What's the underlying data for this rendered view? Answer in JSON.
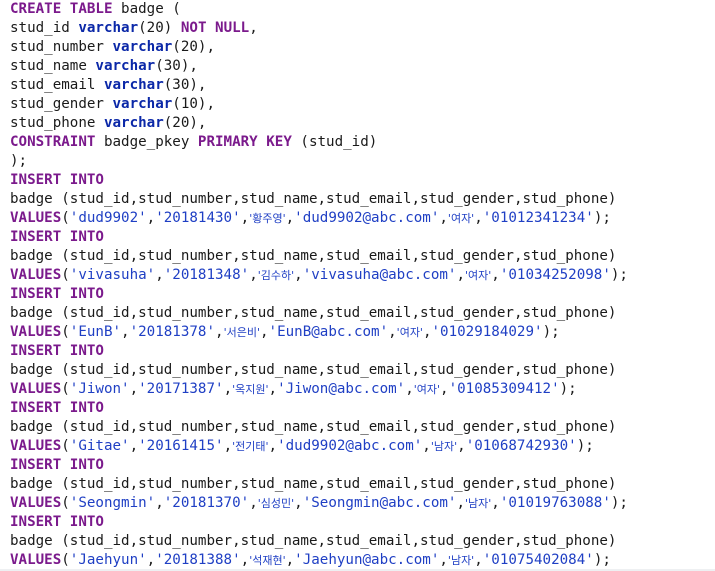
{
  "ddl": {
    "l1": {
      "kw": "CREATE TABLE",
      "rest": " badge ("
    },
    "l2": {
      "col": "stud_id ",
      "type": "varchar",
      "args": "(20) ",
      "kw1": "NOT",
      "sp": " ",
      "kw2": "NULL",
      "tail": ","
    },
    "l3": {
      "col": "stud_number ",
      "type": "varchar",
      "args": "(20),"
    },
    "l4": {
      "col": "stud_name ",
      "type": "varchar",
      "args": "(30),"
    },
    "l5": {
      "col": "stud_email ",
      "type": "varchar",
      "args": "(30),"
    },
    "l6": {
      "col": "stud_gender ",
      "type": "varchar",
      "args": "(10),"
    },
    "l7": {
      "col": "stud_phone ",
      "type": "varchar",
      "args": "(20),"
    },
    "l8": {
      "kw1": "CONSTRAINT",
      "name": " badge_pkey ",
      "kw2": "PRIMARY KEY",
      "tail": " (stud_id)"
    },
    "l9": ");"
  },
  "inserts": [
    {
      "kw": "INSERT INTO",
      "cols": "badge (stud_id,stud_number,stud_name,stud_email,stud_gender,stud_phone)",
      "values_kw": "VALUES",
      "open": "(",
      "id": "'dud9902'",
      "number": "'20181430'",
      "name": "'황주영'",
      "email": "'dud9902@abc.com'",
      "gender": "'여자'",
      "phone": "'01012341234'",
      "close": ");"
    },
    {
      "kw": "INSERT INTO",
      "cols": "badge (stud_id,stud_number,stud_name,stud_email,stud_gender,stud_phone)",
      "values_kw": "VALUES",
      "open": "(",
      "id": "'vivasuha'",
      "number": "'20181348'",
      "name": "'김수하'",
      "email": "'vivasuha@abc.com'",
      "gender": "'여자'",
      "phone": "'01034252098'",
      "close": ");"
    },
    {
      "kw": "INSERT INTO",
      "cols": "badge (stud_id,stud_number,stud_name,stud_email,stud_gender,stud_phone)",
      "values_kw": "VALUES",
      "open": "(",
      "id": "'EunB'",
      "number": "'20181378'",
      "name": "'서은비'",
      "email": "'EunB@abc.com'",
      "gender": "'여자'",
      "phone": "'01029184029'",
      "close": ");"
    },
    {
      "kw": "INSERT INTO",
      "cols": "badge (stud_id,stud_number,stud_name,stud_email,stud_gender,stud_phone)",
      "values_kw": "VALUES",
      "open": "(",
      "id": "'Jiwon'",
      "number": "'20171387'",
      "name": "'옥지원'",
      "email": "'Jiwon@abc.com'",
      "gender": "'여자'",
      "phone": "'01085309412'",
      "close": ");"
    },
    {
      "kw": "INSERT INTO",
      "cols": "badge (stud_id,stud_number,stud_name,stud_email,stud_gender,stud_phone)",
      "values_kw": "VALUES",
      "open": "(",
      "id": "'Gitae'",
      "number": "'20161415'",
      "name": "'전기태'",
      "email": "'dud9902@abc.com'",
      "gender": "'남자'",
      "phone": "'01068742930'",
      "close": ");"
    },
    {
      "kw": "INSERT INTO",
      "cols": "badge (stud_id,stud_number,stud_name,stud_email,stud_gender,stud_phone)",
      "values_kw": "VALUES",
      "open": "(",
      "id": "'Seongmin'",
      "number": "'20181370'",
      "name": "'심성민'",
      "email": "'Seongmin@abc.com'",
      "gender": "'남자'",
      "phone": "'01019763088'",
      "close": ");"
    },
    {
      "kw": "INSERT INTO",
      "cols": "badge (stud_id,stud_number,stud_name,stud_email,stud_gender,stud_phone)",
      "values_kw": "VALUES",
      "open": "(",
      "id": "'Jaehyun'",
      "number": "'20181388'",
      "name": "'석재현'",
      "email": "'Jaehyun@abc.com'",
      "gender": "'남자'",
      "phone": "'01075402084'",
      "close": ");"
    }
  ],
  "colors": {
    "keyword": "#7b1a8c",
    "type": "#0b28a8",
    "string": "#1f3fc4",
    "text": "#1a1a1a",
    "background": "#ffffff"
  }
}
